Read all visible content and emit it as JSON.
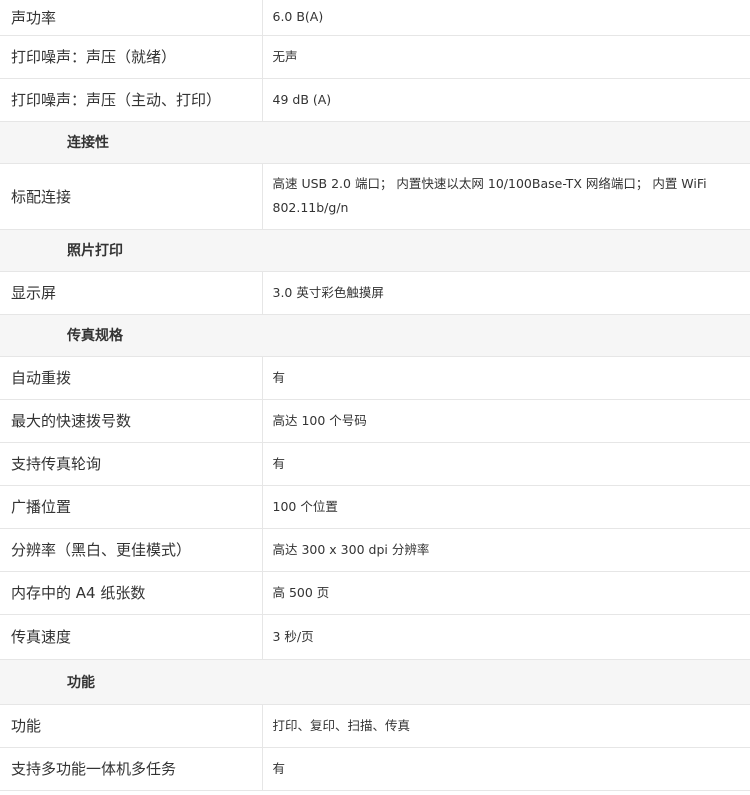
{
  "rows": [
    {
      "type": "row",
      "label": "声功率",
      "value": "6.0 B(A)"
    },
    {
      "type": "row",
      "label": "打印噪声：声压（就绪）",
      "value": "无声"
    },
    {
      "type": "row",
      "label": "打印噪声：声压（主动、打印）",
      "value": "49 dB (A)"
    },
    {
      "type": "section",
      "title": "连接性"
    },
    {
      "type": "row",
      "label": "标配连接",
      "value": "高速 USB 2.0 端口； 内置快速以太网 10/100Base-TX 网络端口； 内置 WiFi 802.11b/g/n"
    },
    {
      "type": "section",
      "title": "照片打印"
    },
    {
      "type": "row",
      "label": "显示屏",
      "value": "3.0 英寸彩色触摸屏"
    },
    {
      "type": "section",
      "title": "传真规格"
    },
    {
      "type": "row",
      "label": "自动重拨",
      "value": "有"
    },
    {
      "type": "row",
      "label": "最大的快速拨号数",
      "value": "高达 100 个号码"
    },
    {
      "type": "row",
      "label": "支持传真轮询",
      "value": "有"
    },
    {
      "type": "row",
      "label": "广播位置",
      "value": "100 个位置"
    },
    {
      "type": "row",
      "label": "分辨率（黑白、更佳模式）",
      "value": "高达 300 x 300 dpi 分辨率"
    },
    {
      "type": "row",
      "label": "内存中的 A4 纸张数",
      "value": "高 500 页"
    },
    {
      "type": "row",
      "label": "传真速度",
      "value": "3 秒/页"
    },
    {
      "type": "section",
      "title": "功能"
    },
    {
      "type": "row",
      "label": "功能",
      "value": "打印、复印、扫描、传真"
    },
    {
      "type": "row",
      "label": "支持多功能一体机多任务",
      "value": "有"
    }
  ]
}
